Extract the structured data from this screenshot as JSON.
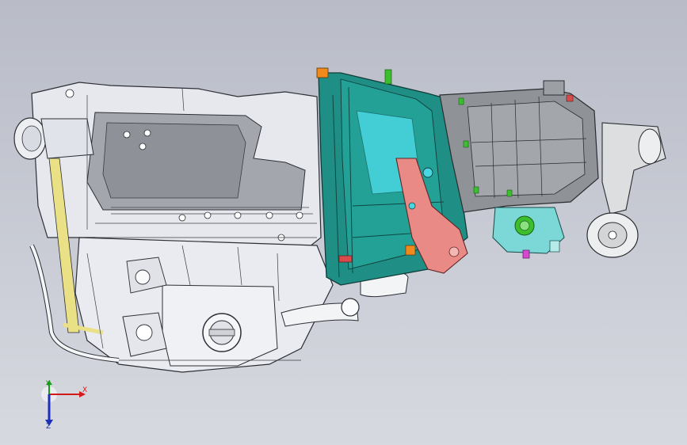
{
  "viewport": {
    "background_top": "#b9bcc7",
    "background_bottom": "#d7d9e0"
  },
  "model": {
    "engine_color": "#e6e8ee",
    "bellhousing_color": "#1f8f86",
    "bellhousing_highlight": "#49d6e0",
    "gearbox_color": "#8f9296",
    "bracket_color": "#e98a86",
    "mount_color": "#dcdedf",
    "accent_green": "#3bbf2d",
    "accent_orange": "#f08a1c"
  },
  "triad": {
    "x_label": "X",
    "y_label": "Y",
    "z_label": "Z",
    "x_color": "#d21a1a",
    "y_color": "#1c9a1c",
    "z_color": "#1e2fb8"
  }
}
